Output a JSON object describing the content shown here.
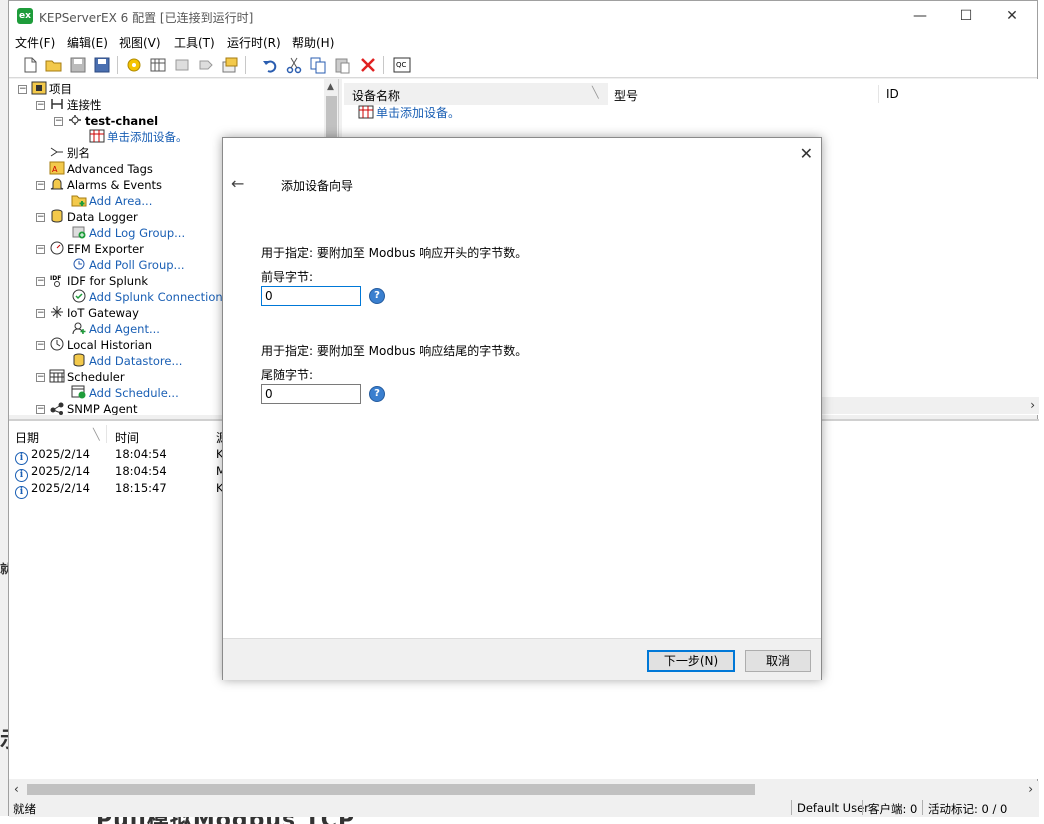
{
  "window": {
    "title": "KEPServerEX 6 配置 [已连接到运行时]",
    "logo": "ex"
  },
  "menu": [
    "文件(F)",
    "编辑(E)",
    "视图(V)",
    "工具(T)",
    "运行时(R)",
    "帮助(H)"
  ],
  "tree": {
    "root": "项目",
    "connectivity": "连接性",
    "channel": "test-chanel",
    "add_device": "单击添加设备。",
    "items": [
      {
        "label": "别名"
      },
      {
        "label": "Advanced Tags"
      },
      {
        "label": "Alarms & Events",
        "child": "Add Area..."
      },
      {
        "label": "Data Logger",
        "child": "Add Log Group..."
      },
      {
        "label": "EFM Exporter",
        "child": "Add Poll Group..."
      },
      {
        "label": "IDF for Splunk",
        "child": "Add Splunk Connection..."
      },
      {
        "label": "IoT Gateway",
        "child": "Add Agent..."
      },
      {
        "label": "Local Historian",
        "child": "Add Datastore..."
      },
      {
        "label": "Scheduler",
        "child": "Add Schedule..."
      },
      {
        "label": "SNMP Agent"
      }
    ]
  },
  "device_pane": {
    "columns": [
      "设备名称",
      "型号",
      "ID"
    ],
    "add_device": "单击添加设备。"
  },
  "log": {
    "columns": [
      "日期",
      "时间",
      "源"
    ],
    "rows": [
      {
        "date": "2025/2/14",
        "time": "18:04:54",
        "source": "K"
      },
      {
        "date": "2025/2/14",
        "time": "18:04:54",
        "source": "M"
      },
      {
        "date": "2025/2/14",
        "time": "18:15:47",
        "source": "K"
      }
    ]
  },
  "status": {
    "ready": "就绪",
    "user": "Default User",
    "clients": "客户端: 0",
    "active_tags": "活动标记: 0 / 0"
  },
  "dialog": {
    "title": "添加设备向导",
    "lead_desc": "用于指定: 要附加至 Modbus 响应开头的字节数。",
    "lead_label": "前导字节:",
    "lead_value": "0",
    "trail_desc": "用于指定: 要附加至 Modbus 响应结尾的字节数。",
    "trail_label": "尾随字节:",
    "trail_value": "0",
    "next": "下一步(N)",
    "cancel": "取消"
  },
  "background_fragment": "Pull模拟Modbus TCP",
  "colors": {
    "accent": "#0078d7",
    "link": "#1a5fb4",
    "logo_green": "#1e9c3a"
  }
}
